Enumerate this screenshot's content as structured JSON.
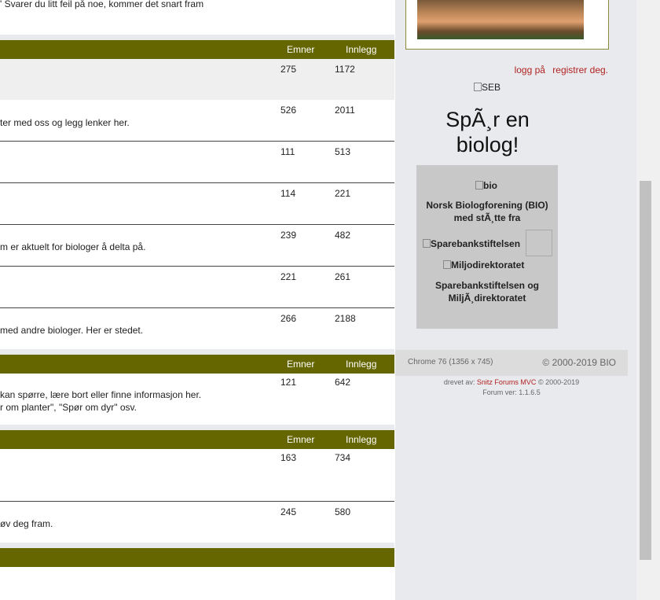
{
  "top_snippet": "' Svarer du litt feil på noe, kommer det snart fram",
  "col_topics": "Emner",
  "col_posts": "Innlegg",
  "section1": {
    "rows": [
      {
        "desc": "",
        "topics": "275",
        "posts": "1172"
      },
      {
        "desc": "ter med oss og legg lenker her.",
        "topics": "526",
        "posts": "2011"
      },
      {
        "desc": "",
        "topics": "111",
        "posts": "513"
      },
      {
        "desc": "",
        "topics": "114",
        "posts": "221"
      },
      {
        "desc": "m er aktuelt for biologer å delta på.",
        "topics": "239",
        "posts": "482"
      },
      {
        "desc": "",
        "topics": "221",
        "posts": "261"
      },
      {
        "desc": "med andre biologer. Her er stedet.",
        "topics": "266",
        "posts": "2188"
      }
    ]
  },
  "section2": {
    "rows": [
      {
        "desc_line1": "kan spørre, lære bort eller finne informasjon her.",
        "desc_line2": "r om planter\", \"Spør om dyr\" osv.",
        "topics": "121",
        "posts": "642"
      }
    ]
  },
  "section3": {
    "rows": [
      {
        "desc": "",
        "topics": "163",
        "posts": "734"
      },
      {
        "desc": "øv deg fram.",
        "topics": "245",
        "posts": "580"
      }
    ]
  },
  "sidebar": {
    "login": "logg på",
    "register": "registrer deg.",
    "seb_alt": "SEB",
    "ask_line1": "SpÃ¸r en",
    "ask_line2": "biolog!",
    "bio_alt": "bio",
    "bio_caption_1": "Norsk Biologforening (BIO)",
    "bio_caption_2": "med stÃ¸tte fra",
    "spb_alt": "Sparebankstiftelsen",
    "miljo_alt": "Miljodirektoratet",
    "support_caption_1": "Sparebankstiftelsen og",
    "support_caption_2": "MiljÃ¸direktoratet"
  },
  "footer": {
    "browser": "Chrome 76 (1356 x 745)",
    "copyright": "© 2000-2019 BIO",
    "powered_prefix": "drevet av:",
    "powered_link": "Snitz Forums MVC",
    "powered_suffix": "© 2000-2019",
    "version": "Forum ver: 1.1.6.5"
  }
}
